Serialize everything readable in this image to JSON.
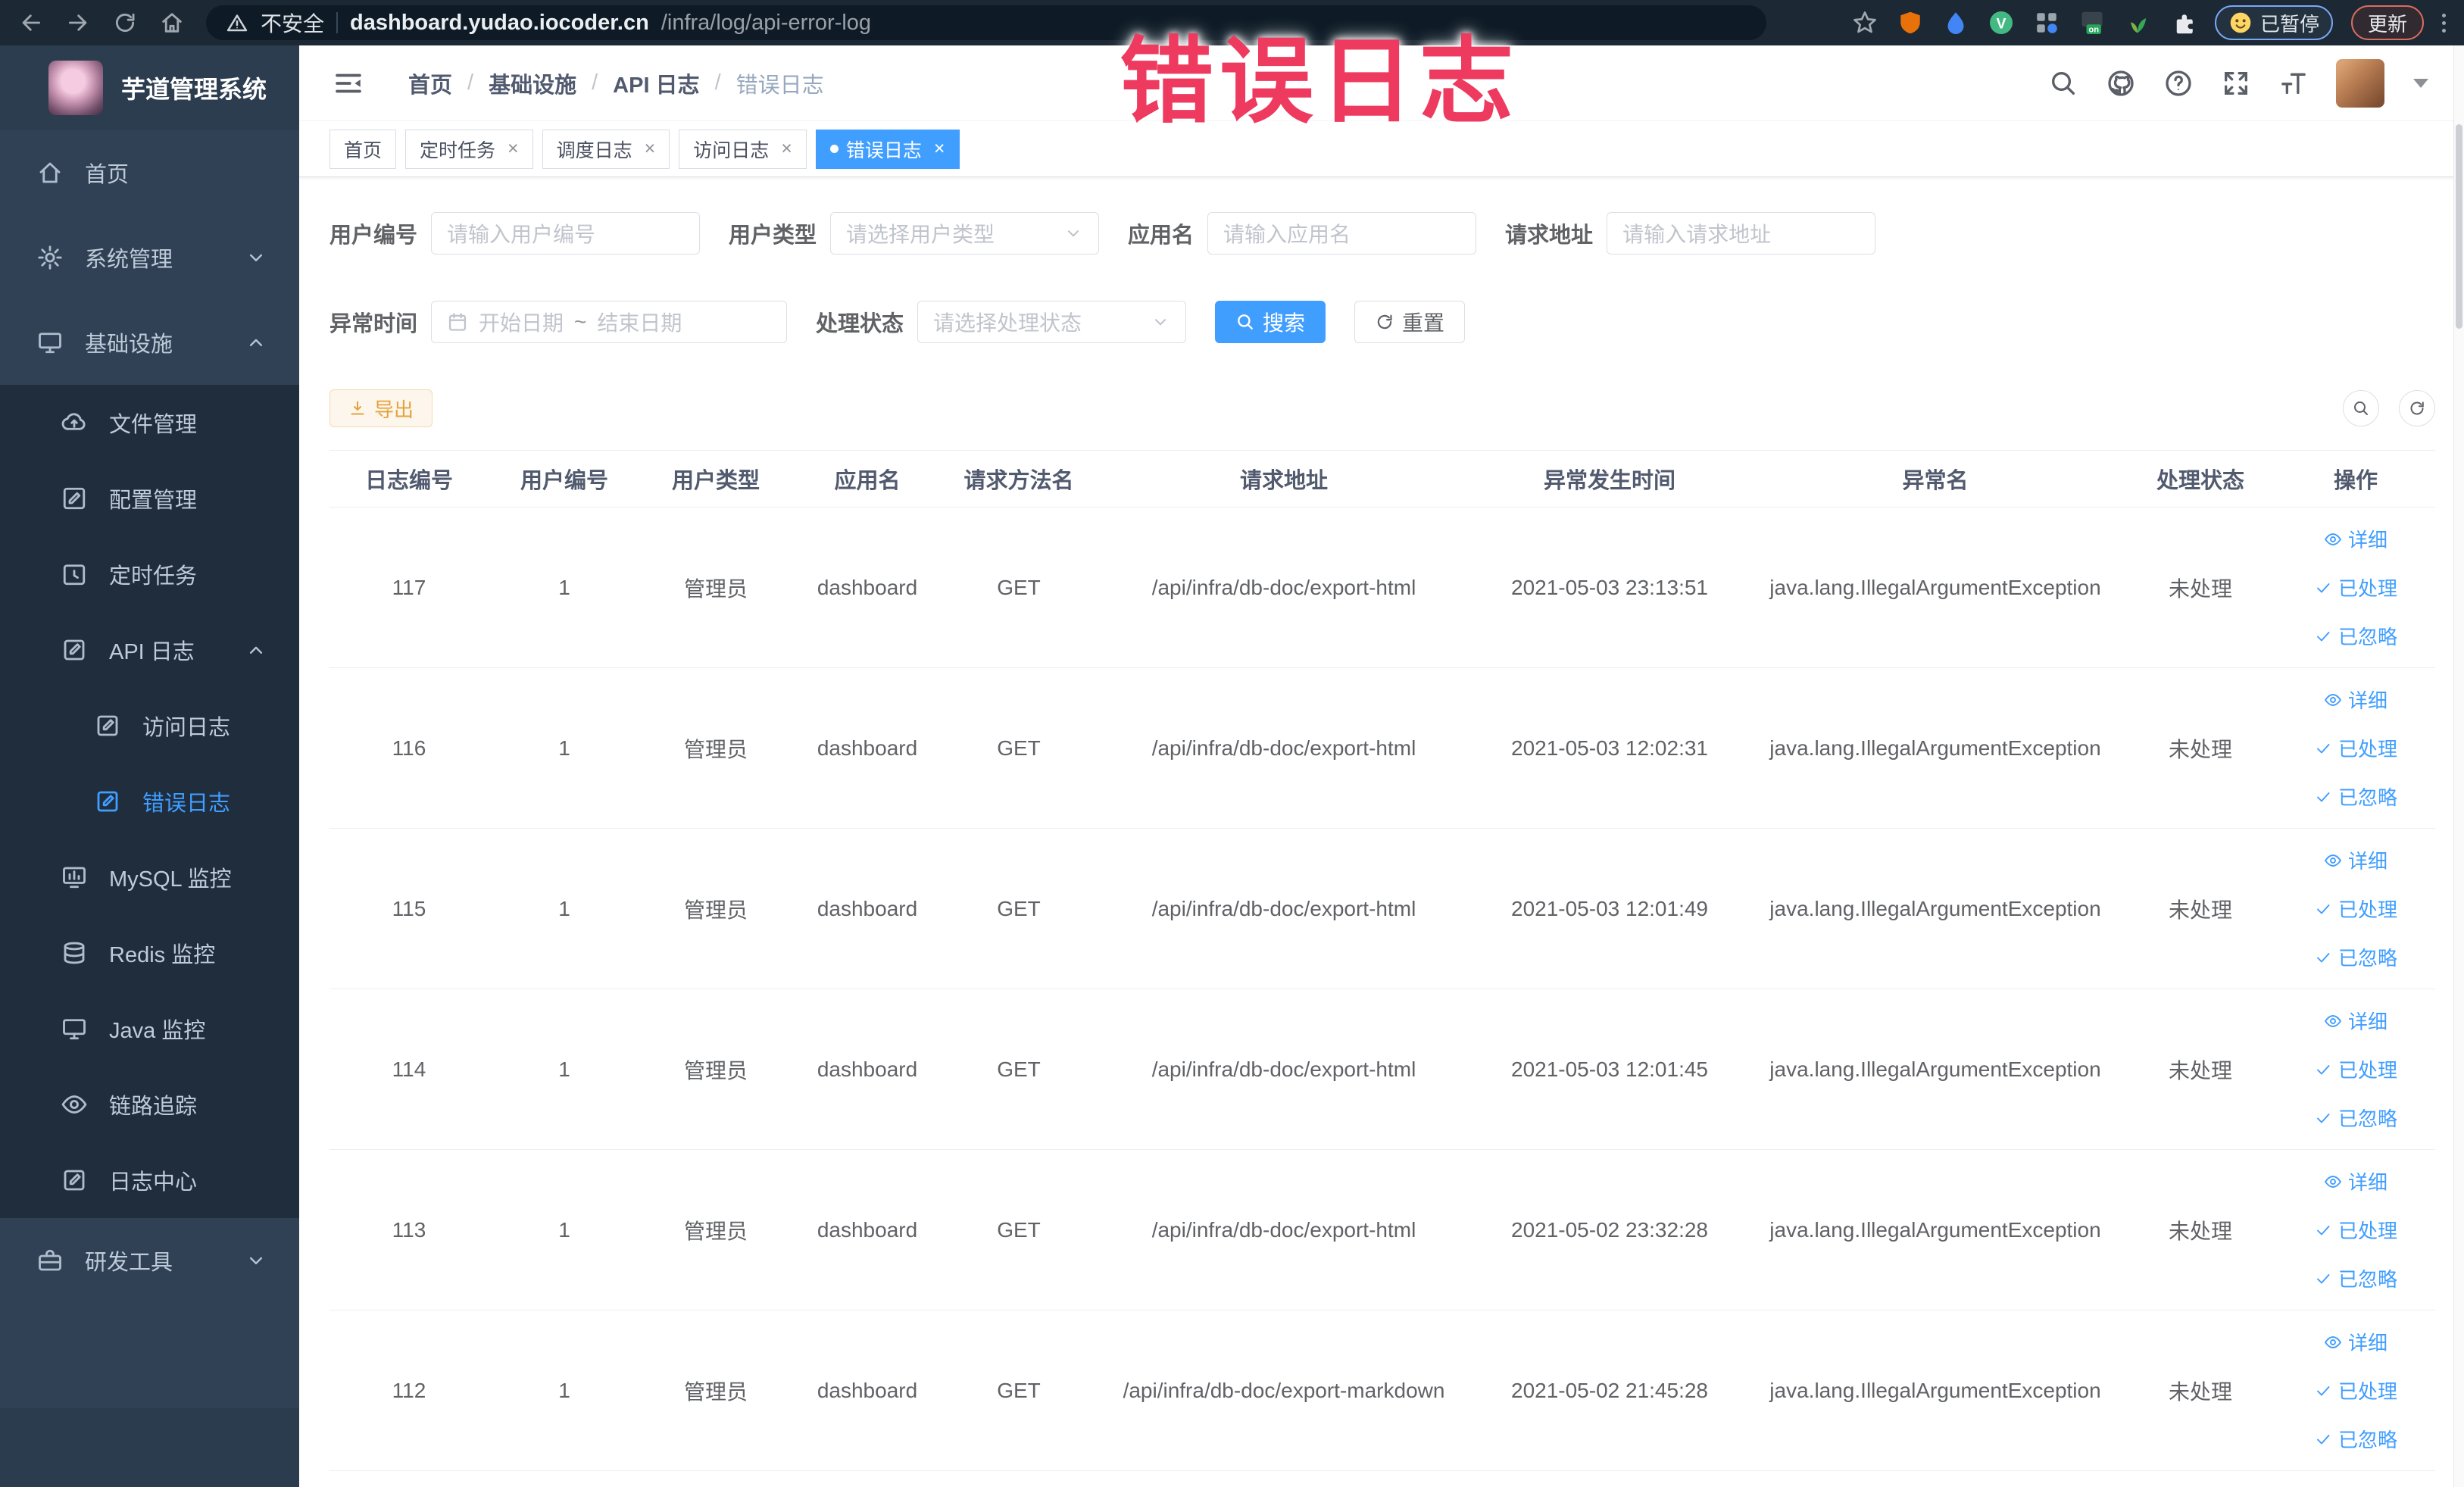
{
  "colors": {
    "accent": "#409eff",
    "annotation": "#ee3a5f",
    "warning_button": "#e6a23c",
    "sidebar_bg": "#304156",
    "submenu_bg": "#1f2d3d"
  },
  "annotation": {
    "text": "错误日志"
  },
  "browser": {
    "security_label": "不安全",
    "url_host": "dashboard.yudao.iocoder.cn",
    "url_path": "/infra/log/api-error-log",
    "on_badge": "on",
    "paused_badge": "已暂停",
    "update_button": "更新",
    "vue_badge": "V"
  },
  "sidebar": {
    "logo_title": "芋道管理系统",
    "items": [
      {
        "key": "home",
        "label": "首页",
        "icon": "home",
        "level": 0
      },
      {
        "key": "system-management",
        "label": "系统管理",
        "icon": "gear",
        "level": 0,
        "chevron": "down"
      },
      {
        "key": "infrastructure",
        "label": "基础设施",
        "icon": "monitor",
        "level": 0,
        "chevron": "up"
      },
      {
        "key": "file-management",
        "label": "文件管理",
        "icon": "cloud",
        "level": 1
      },
      {
        "key": "config-management",
        "label": "配置管理",
        "icon": "edit",
        "level": 1
      },
      {
        "key": "scheduled-tasks",
        "label": "定时任务",
        "icon": "timer",
        "level": 1
      },
      {
        "key": "api-log",
        "label": "API 日志",
        "icon": "logdoc",
        "level": 1,
        "chevron": "up"
      },
      {
        "key": "access-log",
        "label": "访问日志",
        "icon": "logdoc",
        "level": 2
      },
      {
        "key": "error-log",
        "label": "错误日志",
        "icon": "logdoc",
        "level": 2,
        "active": true
      },
      {
        "key": "mysql-monitor",
        "label": "MySQL 监控",
        "icon": "chart",
        "level": 1
      },
      {
        "key": "redis-monitor",
        "label": "Redis 监控",
        "icon": "stack",
        "level": 1
      },
      {
        "key": "java-monitor",
        "label": "Java 监控",
        "icon": "monitor",
        "level": 1
      },
      {
        "key": "trace",
        "label": "链路追踪",
        "icon": "eye",
        "level": 1
      },
      {
        "key": "log-center",
        "label": "日志中心",
        "icon": "logdoc",
        "level": 1
      },
      {
        "key": "dev-tools",
        "label": "研发工具",
        "icon": "toolbox",
        "level": 0,
        "chevron": "down"
      }
    ]
  },
  "breadcrumb": {
    "items": [
      "首页",
      "基础设施",
      "API 日志",
      "错误日志"
    ]
  },
  "tabs": [
    {
      "key": "home",
      "label": "首页",
      "closable": false,
      "active": false
    },
    {
      "key": "scheduled-tasks",
      "label": "定时任务",
      "closable": true,
      "active": false
    },
    {
      "key": "schedule-log",
      "label": "调度日志",
      "closable": true,
      "active": false
    },
    {
      "key": "access-log",
      "label": "访问日志",
      "closable": true,
      "active": false
    },
    {
      "key": "error-log",
      "label": "错误日志",
      "closable": true,
      "active": true
    }
  ],
  "filters": {
    "user_id_label": "用户编号",
    "user_id_placeholder": "请输入用户编号",
    "user_type_label": "用户类型",
    "user_type_placeholder": "请选择用户类型",
    "app_name_label": "应用名",
    "app_name_placeholder": "请输入应用名",
    "request_url_label": "请求地址",
    "request_url_placeholder": "请输入请求地址",
    "exception_time_label": "异常时间",
    "date_start_placeholder": "开始日期",
    "date_separator": "~",
    "date_end_placeholder": "结束日期",
    "process_status_label": "处理状态",
    "process_status_placeholder": "请选择处理状态",
    "search_button": "搜索",
    "reset_button": "重置"
  },
  "toolbar": {
    "export_button": "导出"
  },
  "table": {
    "columns": [
      "日志编号",
      "用户编号",
      "用户类型",
      "应用名",
      "请求方法名",
      "请求地址",
      "异常发生时间",
      "异常名",
      "处理状态",
      "操作"
    ],
    "actions": [
      "详细",
      "已处理",
      "已忽略"
    ],
    "rows": [
      {
        "id": "117",
        "user_id": "1",
        "user_type": "管理员",
        "app": "dashboard",
        "method": "GET",
        "url": "/api/infra/db-doc/export-html",
        "time": "2021-05-03 23:13:51",
        "exception": "java.lang.IllegalArgumentException",
        "status": "未处理"
      },
      {
        "id": "116",
        "user_id": "1",
        "user_type": "管理员",
        "app": "dashboard",
        "method": "GET",
        "url": "/api/infra/db-doc/export-html",
        "time": "2021-05-03 12:02:31",
        "exception": "java.lang.IllegalArgumentException",
        "status": "未处理"
      },
      {
        "id": "115",
        "user_id": "1",
        "user_type": "管理员",
        "app": "dashboard",
        "method": "GET",
        "url": "/api/infra/db-doc/export-html",
        "time": "2021-05-03 12:01:49",
        "exception": "java.lang.IllegalArgumentException",
        "status": "未处理"
      },
      {
        "id": "114",
        "user_id": "1",
        "user_type": "管理员",
        "app": "dashboard",
        "method": "GET",
        "url": "/api/infra/db-doc/export-html",
        "time": "2021-05-03 12:01:45",
        "exception": "java.lang.IllegalArgumentException",
        "status": "未处理"
      },
      {
        "id": "113",
        "user_id": "1",
        "user_type": "管理员",
        "app": "dashboard",
        "method": "GET",
        "url": "/api/infra/db-doc/export-html",
        "time": "2021-05-02 23:32:28",
        "exception": "java.lang.IllegalArgumentException",
        "status": "未处理"
      },
      {
        "id": "112",
        "user_id": "1",
        "user_type": "管理员",
        "app": "dashboard",
        "method": "GET",
        "url": "/api/infra/db-doc/export-markdown",
        "time": "2021-05-02 21:45:28",
        "exception": "java.lang.IllegalArgumentException",
        "status": "未处理"
      }
    ]
  }
}
